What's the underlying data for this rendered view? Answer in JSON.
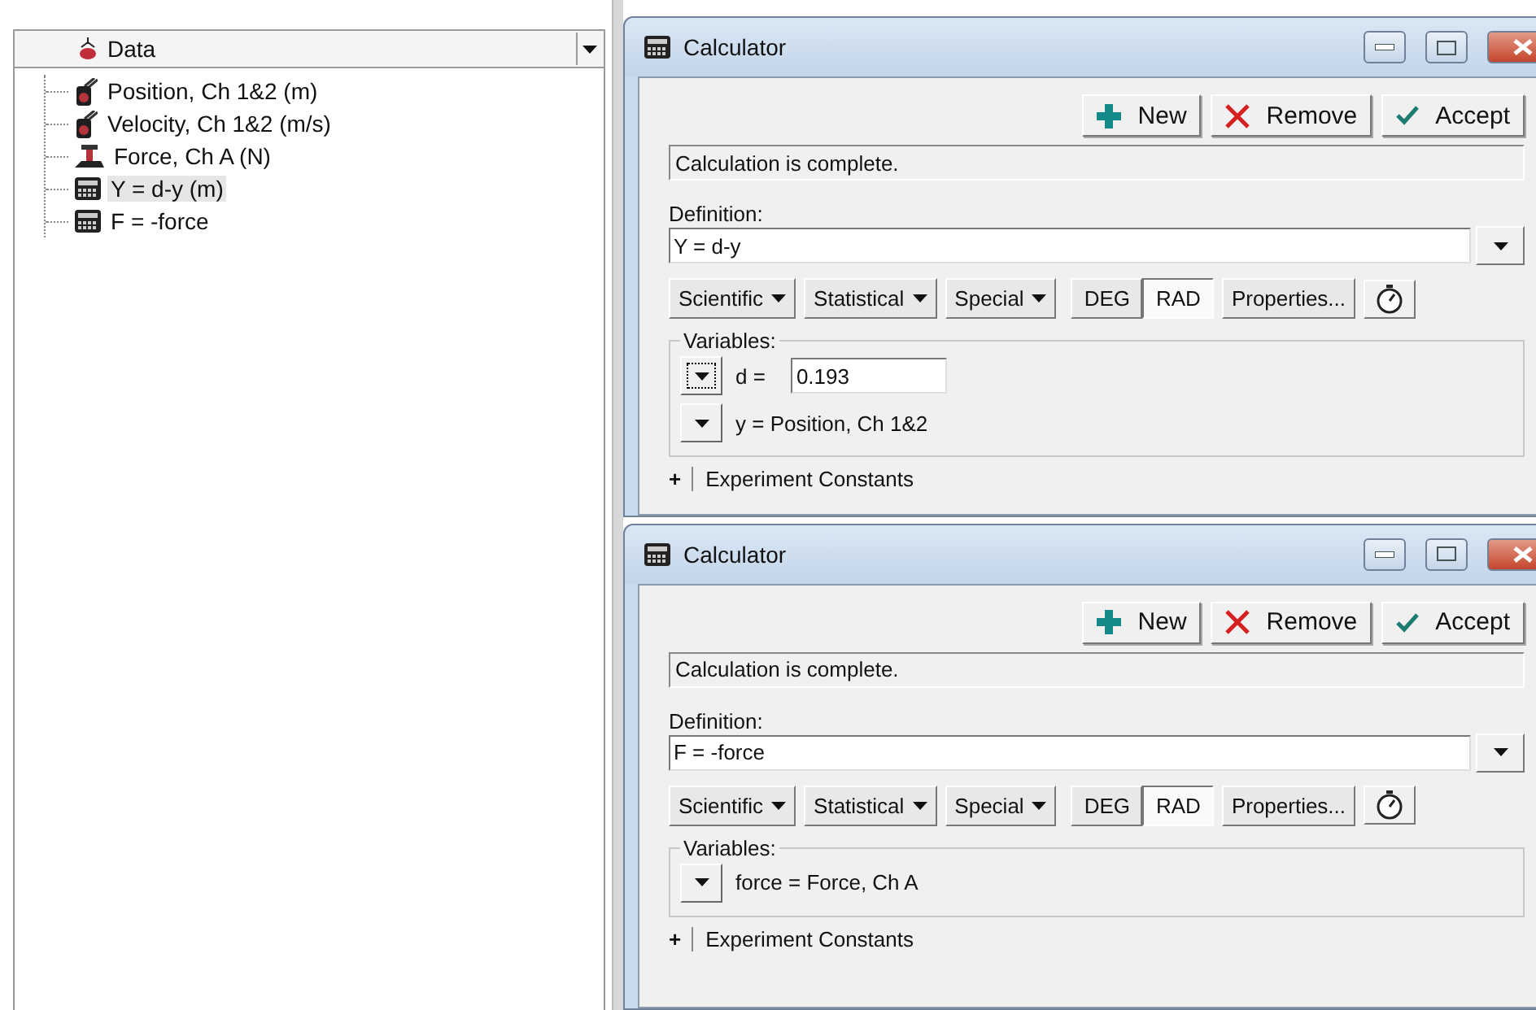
{
  "data_panel": {
    "title": "Data",
    "items": [
      {
        "label": "Position, Ch 1&2 (m)",
        "kind": "sensor",
        "selected": false
      },
      {
        "label": "Velocity, Ch 1&2 (m/s)",
        "kind": "sensor",
        "selected": false
      },
      {
        "label": "Force, Ch A (N)",
        "kind": "force",
        "selected": false
      },
      {
        "label": "Y = d-y (m)",
        "kind": "calc",
        "selected": true
      },
      {
        "label": "F = -force",
        "kind": "calc",
        "selected": false
      }
    ]
  },
  "windows": [
    {
      "title": "Calculator",
      "actions": [
        {
          "label": "New",
          "kind": "new"
        },
        {
          "label": "Remove",
          "kind": "remove"
        },
        {
          "label": "Accept",
          "kind": "accept"
        }
      ],
      "status": "Calculation is complete.",
      "definition_label": "Definition:",
      "definition": "Y = d-y",
      "menus": [
        "Scientific",
        "Statistical",
        "Special"
      ],
      "angle_modes": [
        {
          "label": "DEG",
          "selected": false
        },
        {
          "label": "RAD",
          "selected": true
        }
      ],
      "properties": "Properties...",
      "variables_label": "Variables:",
      "variables": [
        {
          "kind": "constant",
          "label": "d =",
          "value": "0.193",
          "focused": true
        },
        {
          "kind": "link",
          "label": "y = Position, Ch 1&2",
          "focused": false
        }
      ],
      "constants": {
        "toggle": "+",
        "label": "Experiment Constants"
      }
    },
    {
      "title": "Calculator",
      "actions": [
        {
          "label": "New",
          "kind": "new"
        },
        {
          "label": "Remove",
          "kind": "remove"
        },
        {
          "label": "Accept",
          "kind": "accept"
        }
      ],
      "status": "Calculation is complete.",
      "definition_label": "Definition:",
      "definition": "F = -force",
      "menus": [
        "Scientific",
        "Statistical",
        "Special"
      ],
      "angle_modes": [
        {
          "label": "DEG",
          "selected": false
        },
        {
          "label": "RAD",
          "selected": true
        }
      ],
      "properties": "Properties...",
      "variables_label": "Variables:",
      "variables": [
        {
          "kind": "link",
          "label": "force = Force, Ch A",
          "focused": false
        }
      ],
      "constants": {
        "toggle": "+",
        "label": "Experiment Constants"
      }
    }
  ]
}
